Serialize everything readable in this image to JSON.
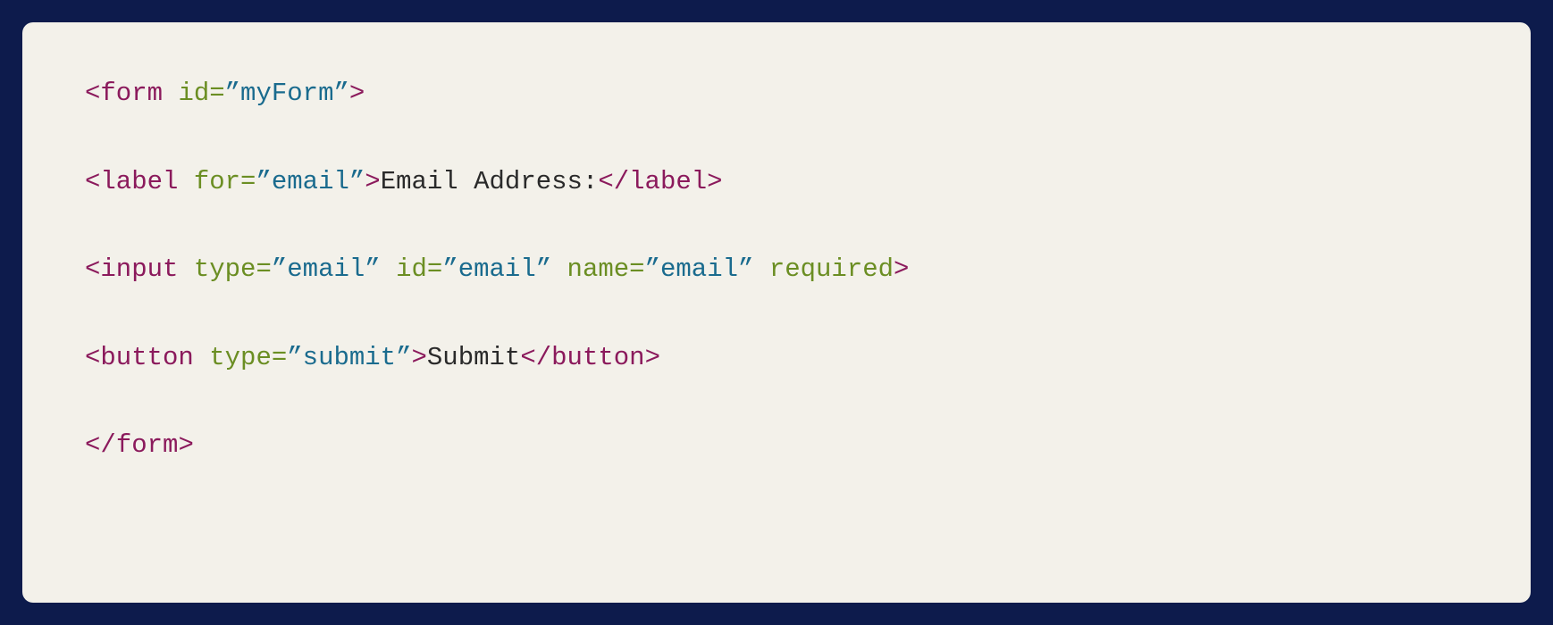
{
  "code": {
    "line1": {
      "open_bracket": "<",
      "tag": "form",
      "space1": " ",
      "attr1_name": "id",
      "attr1_eq": "=",
      "attr1_val": "”myForm”",
      "close_bracket": ">"
    },
    "line2": {
      "open_bracket": "<",
      "tag": "label",
      "space1": " ",
      "attr1_name": "for",
      "attr1_eq": "=",
      "attr1_val": "”email”",
      "close_bracket": ">",
      "text": "Email Address:",
      "close_open": "</",
      "close_tag": "label",
      "close_close": ">"
    },
    "line3": {
      "open_bracket": "<",
      "tag": "input",
      "space1": " ",
      "attr1_name": "type",
      "attr1_eq": "=",
      "attr1_val": "”email”",
      "space2": " ",
      "attr2_name": "id",
      "attr2_eq": "=",
      "attr2_val": "”email”",
      "space3": " ",
      "attr3_name": "name",
      "attr3_eq": "=",
      "attr3_val": "”email”",
      "space4": " ",
      "attr4_name": "required",
      "close_bracket": ">"
    },
    "line4": {
      "open_bracket": "<",
      "tag": "button",
      "space1": " ",
      "attr1_name": "type",
      "attr1_eq": "=",
      "attr1_val": "”submit”",
      "close_bracket": ">",
      "text": "Submit",
      "close_open": "</",
      "close_tag": "button",
      "close_close": ">"
    },
    "line5": {
      "close_open": "</",
      "close_tag": "form",
      "close_close": ">"
    }
  }
}
